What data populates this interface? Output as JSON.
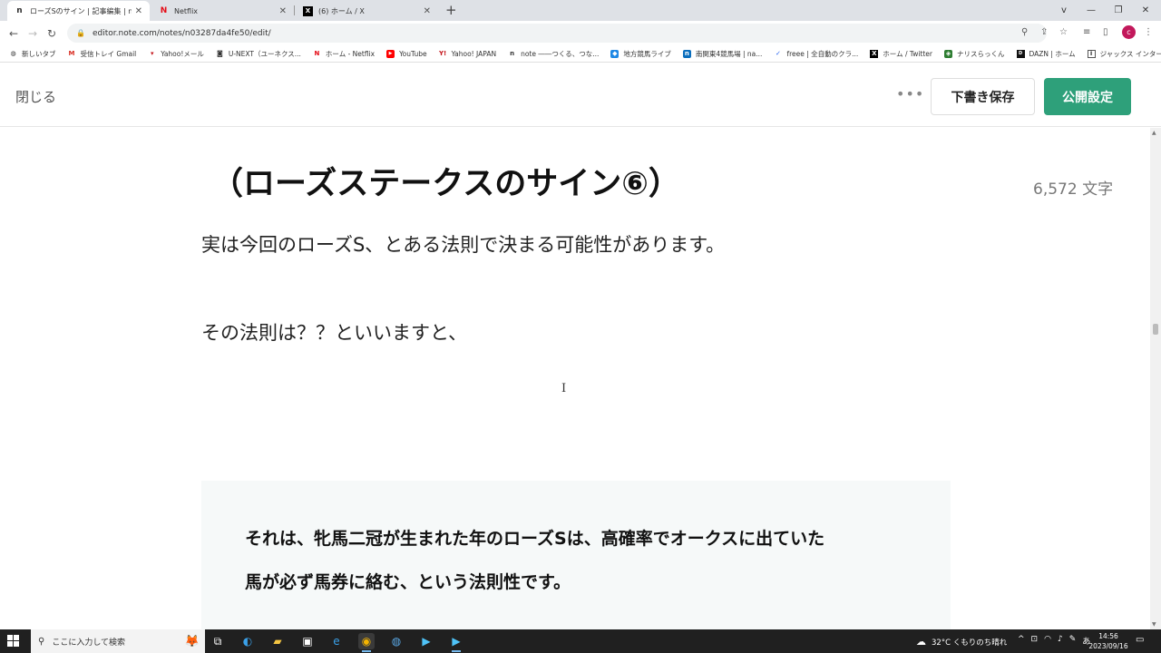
{
  "browser": {
    "tabs": [
      {
        "title": "ローズSのサイン | 記事編集 | note",
        "favicon": "n"
      },
      {
        "title": "Netflix",
        "favicon": "N"
      },
      {
        "title": "(6) ホーム / X",
        "favicon": "X"
      }
    ],
    "new_tab_icon": "plus-icon",
    "window_controls": [
      "v",
      "—",
      "❐",
      "✕"
    ],
    "url": "editor.note.com/notes/n03287da4fe50/edit/",
    "bookmarks": [
      {
        "label": "新しいタブ",
        "icon": "globe-icon"
      },
      {
        "label": "受信トレイ Gmail",
        "icon": "gmail-icon"
      },
      {
        "label": "Yahoo!メール",
        "icon": "yahoo-mail-icon"
      },
      {
        "label": "U-NEXT（ユーネクス...",
        "icon": "unext-icon"
      },
      {
        "label": "ホーム - Netflix",
        "icon": "netflix-icon"
      },
      {
        "label": "YouTube",
        "icon": "youtube-icon"
      },
      {
        "label": "Yahoo! JAPAN",
        "icon": "yahoo-icon"
      },
      {
        "label": "note ――つくる、つな...",
        "icon": "note-icon"
      },
      {
        "label": "地方競馬ライブ",
        "icon": "keiba-icon"
      },
      {
        "label": "南関東4競馬場 | na...",
        "icon": "nankan-icon"
      },
      {
        "label": "freee | 全自動のクラ...",
        "icon": "freee-icon"
      },
      {
        "label": "ホーム / Twitter",
        "icon": "x-icon"
      },
      {
        "label": "ナリスらっくん",
        "icon": "app-icon"
      },
      {
        "label": "DAZN | ホーム",
        "icon": "dazn-icon"
      },
      {
        "label": "ジャックス インターコム...",
        "icon": "jaccs-icon"
      }
    ]
  },
  "editor": {
    "close_label": "閉じる",
    "more_label": "•••",
    "draft_label": "下書き保存",
    "publish_label": "公開設定",
    "word_count": "6,572 文字",
    "heading": "（ローズステークスのサイン⑥）",
    "para1": "実は今回のローズS、とある法則で決まる可能性があります。",
    "para2": "その法則は？？といいますと、",
    "cursor": "I",
    "quote_line1": "それは、牝馬二冠が生まれた年のローズSは、高確率でオークスに出ていた",
    "quote_line2": "馬が必ず馬券に絡む、という法則性です。"
  },
  "taskbar": {
    "search_placeholder": "ここに入力して検索",
    "weather": "32°C くもりのち晴れ",
    "ime": "あ",
    "time": "14:56",
    "date": "2023/09/16"
  },
  "colors": {
    "publish_green": "#2ea07a",
    "quote_bg": "#f6f9f9",
    "taskbar": "#202020"
  }
}
